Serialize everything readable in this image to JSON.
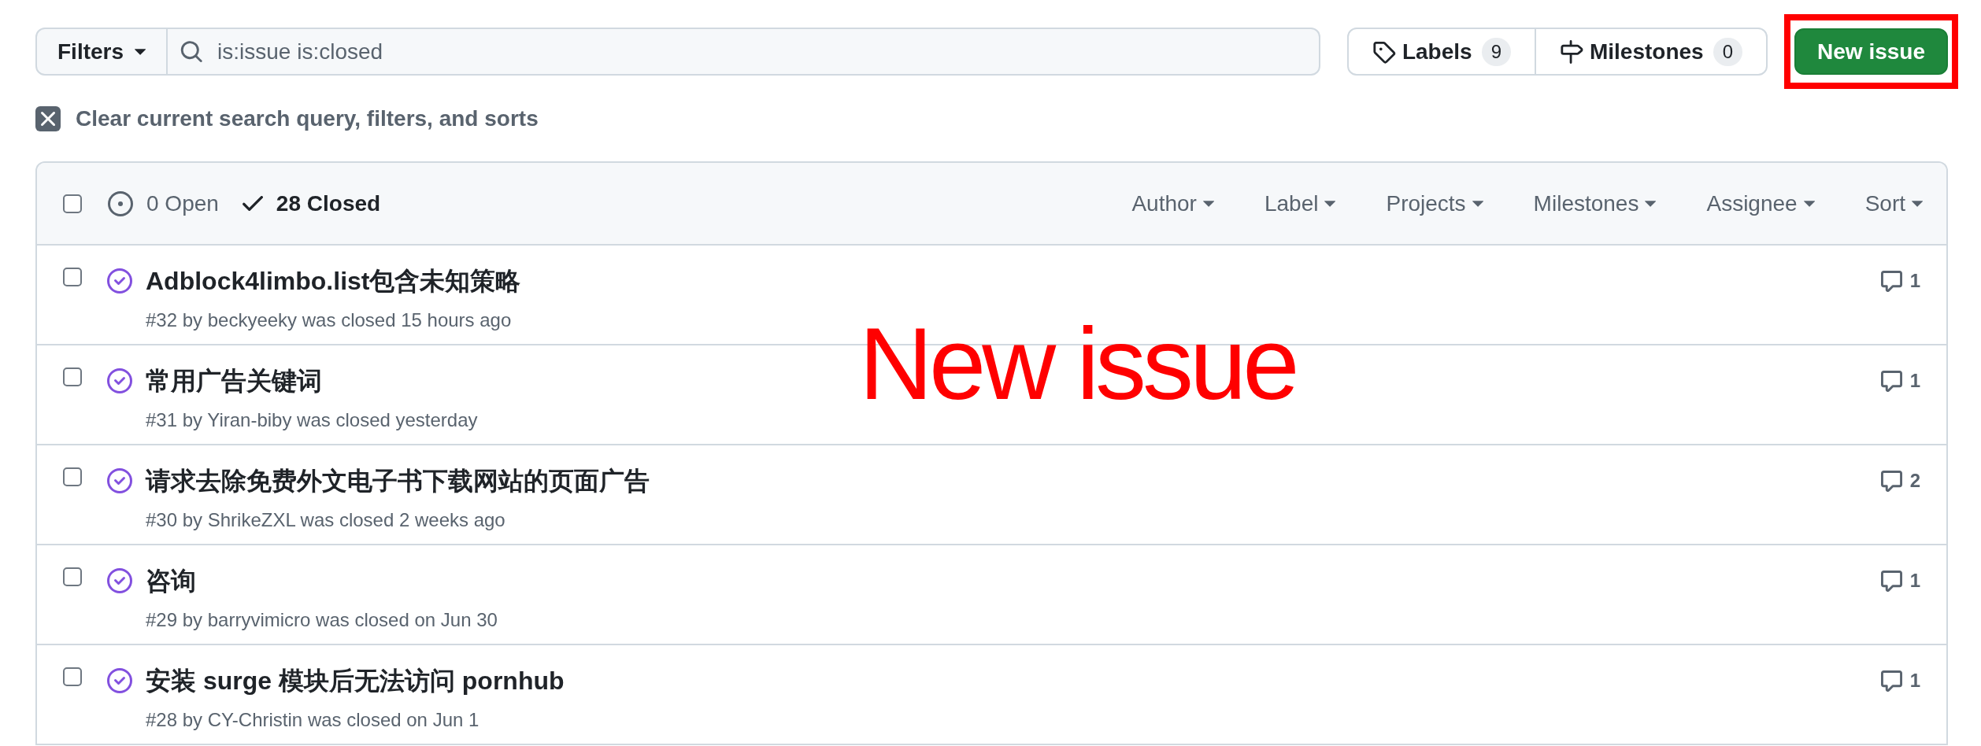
{
  "search": {
    "filter_button": "Filters",
    "query": "is:issue is:closed"
  },
  "labels_button": {
    "label": "Labels",
    "count": "9"
  },
  "milestones_button": {
    "label": "Milestones",
    "count": "0"
  },
  "new_issue_button": {
    "label": "New issue",
    "highlighted": true
  },
  "clear_filters": "Clear current search query, filters, and sorts",
  "list_header": {
    "select_all": {
      "checked": false
    },
    "tabs": [
      {
        "kind": "open",
        "label": "0 Open",
        "selected": false
      },
      {
        "kind": "closed",
        "label": "28 Closed",
        "selected": true
      }
    ],
    "filters": [
      "Author",
      "Label",
      "Projects",
      "Milestones",
      "Assignee",
      "Sort"
    ]
  },
  "issues": [
    {
      "checked": false,
      "closed": true,
      "title": "Adblock4limbo.list包含未知策略",
      "meta": "#32 by beckyeeky was closed 15 hours ago",
      "comments": "1"
    },
    {
      "checked": false,
      "closed": true,
      "title": "常用广告关键词",
      "meta": "#31 by Yiran-biby was closed yesterday",
      "comments": "1"
    },
    {
      "checked": false,
      "closed": true,
      "title": "请求去除免费外文电子书下载网站的页面广告",
      "meta": "#30 by ShrikeZXL was closed 2 weeks ago",
      "comments": "2"
    },
    {
      "checked": false,
      "closed": true,
      "title": "咨询",
      "meta": "#29 by barryvimicro was closed on Jun 30",
      "comments": "1"
    },
    {
      "checked": false,
      "closed": true,
      "title": "安装 surge 模块后无法访问 pornhub",
      "meta": "#28 by CY-Christin was closed on Jun 1",
      "comments": "1"
    }
  ],
  "annotation": {
    "text": "New issue"
  }
}
